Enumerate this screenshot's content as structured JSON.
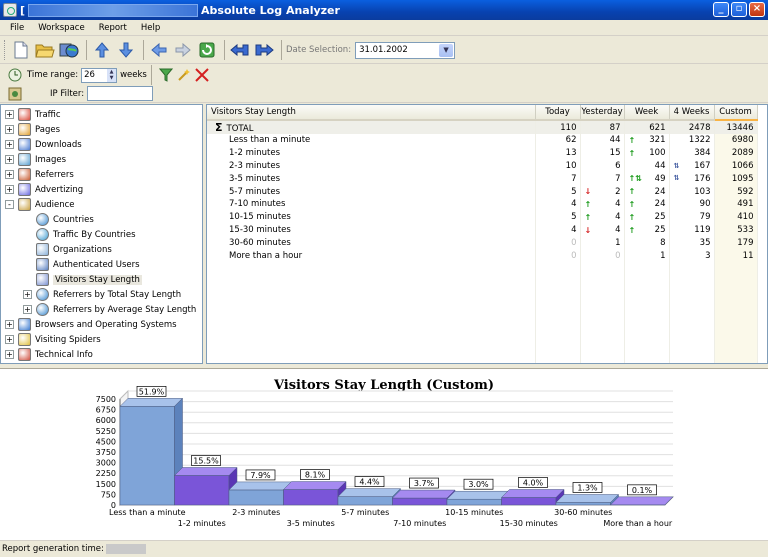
{
  "window": {
    "title": "Absolute Log Analyzer",
    "title_prefix": "["
  },
  "menu": [
    "File",
    "Workspace",
    "Report",
    "Help"
  ],
  "toolbar": {
    "icons": [
      "new-icon",
      "open-icon",
      "web-icon",
      "up-arrow-icon",
      "down-arrow-icon",
      "back-icon",
      "forward-icon",
      "refresh-icon",
      "previous-report-icon",
      "next-report-icon"
    ],
    "date_selection_label": "Date Selection:",
    "date_selection_value": "31.01.2002"
  },
  "filters": {
    "time_range_label": "Time range:",
    "time_range_value": "26",
    "time_range_unit": "weeks",
    "ip_filter_label": "IP Filter:",
    "ip_filter_value": ""
  },
  "tree": [
    {
      "label": "Traffic",
      "level": 0,
      "expander": "+",
      "icon": "traffic-icon"
    },
    {
      "label": "Pages",
      "level": 0,
      "expander": "+",
      "icon": "pages-icon"
    },
    {
      "label": "Downloads",
      "level": 0,
      "expander": "+",
      "icon": "downloads-icon"
    },
    {
      "label": "Images",
      "level": 0,
      "expander": "+",
      "icon": "images-icon"
    },
    {
      "label": "Referrers",
      "level": 0,
      "expander": "+",
      "icon": "referrers-icon"
    },
    {
      "label": "Advertizing",
      "level": 0,
      "expander": "+",
      "icon": "advertizing-icon"
    },
    {
      "label": "Audience",
      "level": 0,
      "expander": "-",
      "icon": "audience-icon"
    },
    {
      "label": "Countries",
      "level": 1,
      "expander": "",
      "icon": "globe-icon"
    },
    {
      "label": "Traffic By Countries",
      "level": 1,
      "expander": "",
      "icon": "globe-icon"
    },
    {
      "label": "Organizations",
      "level": 1,
      "expander": "",
      "icon": "organizations-icon"
    },
    {
      "label": "Authenticated Users",
      "level": 1,
      "expander": "",
      "icon": "users-icon"
    },
    {
      "label": "Visitors Stay Length",
      "level": 1,
      "expander": "",
      "icon": "stay-length-icon",
      "selected": true
    },
    {
      "label": "Referrers by Total Stay Length",
      "level": 1,
      "expander": "+",
      "icon": "globe-icon"
    },
    {
      "label": "Referrers by Average Stay Length",
      "level": 1,
      "expander": "+",
      "icon": "globe-icon"
    },
    {
      "label": "Browsers and Operating Systems",
      "level": 0,
      "expander": "+",
      "icon": "browsers-icon"
    },
    {
      "label": "Visiting Spiders",
      "level": 0,
      "expander": "+",
      "icon": "spiders-icon"
    },
    {
      "label": "Technical Info",
      "level": 0,
      "expander": "+",
      "icon": "technical-icon"
    }
  ],
  "grid": {
    "columns": [
      "Visitors Stay Length",
      "Today",
      "Yesterday",
      "Week",
      "4 Weeks",
      "Custom"
    ],
    "total": {
      "name": "TOTAL",
      "values": [
        "110",
        "87",
        "621",
        "2478",
        "13446"
      ]
    },
    "rows": [
      {
        "name": "Less than a minute",
        "values": [
          "62",
          "44",
          "321",
          "1322",
          "6980"
        ],
        "trend": [
          "",
          "",
          "up",
          "",
          ""
        ]
      },
      {
        "name": "1-2 minutes",
        "values": [
          "13",
          "15",
          "100",
          "384",
          "2089"
        ],
        "trend": [
          "",
          "",
          "up",
          "",
          ""
        ]
      },
      {
        "name": "2-3 minutes",
        "values": [
          "10",
          "6",
          "44",
          "167",
          "1066"
        ],
        "trend": [
          "",
          "",
          "",
          "mixed",
          ""
        ]
      },
      {
        "name": "3-5 minutes",
        "values": [
          "7",
          "7",
          "49",
          "176",
          "1095"
        ],
        "trend": [
          "",
          "",
          "upmixed",
          "mixed",
          ""
        ]
      },
      {
        "name": "5-7 minutes",
        "values": [
          "5",
          "2",
          "24",
          "103",
          "592"
        ],
        "trend": [
          "",
          "down",
          "up",
          "",
          ""
        ]
      },
      {
        "name": "7-10 minutes",
        "values": [
          "4",
          "4",
          "24",
          "90",
          "491"
        ],
        "trend": [
          "",
          "up",
          "up",
          "",
          ""
        ]
      },
      {
        "name": "10-15 minutes",
        "values": [
          "5",
          "4",
          "25",
          "79",
          "410"
        ],
        "trend": [
          "",
          "up",
          "up",
          "",
          ""
        ]
      },
      {
        "name": "15-30 minutes",
        "values": [
          "4",
          "4",
          "25",
          "119",
          "533"
        ],
        "trend": [
          "",
          "down",
          "up",
          "",
          ""
        ]
      },
      {
        "name": "30-60 minutes",
        "values": [
          "0",
          "1",
          "8",
          "35",
          "179"
        ],
        "trend": [
          "",
          "",
          "",
          "",
          ""
        ]
      },
      {
        "name": "More than a hour",
        "values": [
          "0",
          "0",
          "1",
          "3",
          "11"
        ],
        "trend": [
          "",
          "",
          "",
          "",
          ""
        ]
      }
    ]
  },
  "chart_data": {
    "type": "bar",
    "title": "Visitors Stay Length (Custom)",
    "categories": [
      "Less than a minute",
      "1-2 minutes",
      "2-3 minutes",
      "3-5 minutes",
      "5-7 minutes",
      "7-10 minutes",
      "10-15 minutes",
      "15-30 minutes",
      "30-60 minutes",
      "More than a hour"
    ],
    "values": [
      6980,
      2089,
      1066,
      1095,
      592,
      491,
      410,
      533,
      179,
      11
    ],
    "data_labels": [
      "51.9%",
      "15.5%",
      "7.9%",
      "8.1%",
      "4.4%",
      "3.7%",
      "3.0%",
      "4.0%",
      "1.3%",
      "0.1%"
    ],
    "yticks": [
      0,
      750,
      1500,
      2250,
      3000,
      3750,
      4500,
      5250,
      6000,
      6750,
      7500
    ],
    "ylim": [
      0,
      7500
    ],
    "colors": [
      "#7fa4d8",
      "#7a55d8"
    ],
    "grid": true,
    "legend": "none"
  },
  "status": {
    "label": "Report generation time:"
  }
}
